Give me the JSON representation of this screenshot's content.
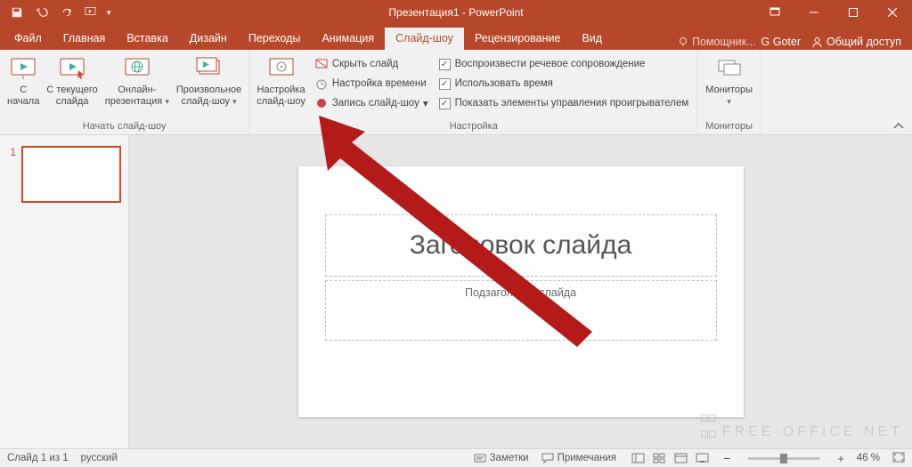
{
  "title": "Презентация1 - PowerPoint",
  "tabs": {
    "file": "Файл",
    "home": "Главная",
    "insert": "Вставка",
    "design": "Дизайн",
    "transitions": "Переходы",
    "animations": "Анимация",
    "slideshow": "Слайд-шоу",
    "review": "Рецензирование",
    "view": "Вид"
  },
  "tellme": "Помощник...",
  "user": "G Goter",
  "share": "Общий доступ",
  "ribbon": {
    "group1": {
      "label": "Начать слайд-шоу",
      "from_start_1": "С",
      "from_start_2": "начала",
      "from_current_1": "С текущего",
      "from_current_2": "слайда",
      "online_1": "Онлайн-",
      "online_2": "презентация",
      "custom_1": "Произвольное",
      "custom_2": "слайд-шоу"
    },
    "group2": {
      "label": "Настройка",
      "setup_1": "Настройка",
      "setup_2": "слайд-шоу",
      "hide": "Скрыть слайд",
      "rehearse": "Настройка времени",
      "record": "Запись слайд-шоу",
      "chk_narr": "Воспроизвести речевое сопровождение",
      "chk_timings": "Использовать время",
      "chk_controls": "Показать элементы управления проигрывателем"
    },
    "group3": {
      "label": "Мониторы",
      "monitors": "Мониторы"
    }
  },
  "thumbs": {
    "n1": "1"
  },
  "slide": {
    "title": "Заголовок слайда",
    "subtitle": "Подзаголовок слайда"
  },
  "status": {
    "slide": "Слайд 1 из 1",
    "lang": "русский",
    "notes": "Заметки",
    "comments": "Примечания",
    "zoom": "46 %"
  },
  "watermark": "FREE-OFFICE.NET"
}
